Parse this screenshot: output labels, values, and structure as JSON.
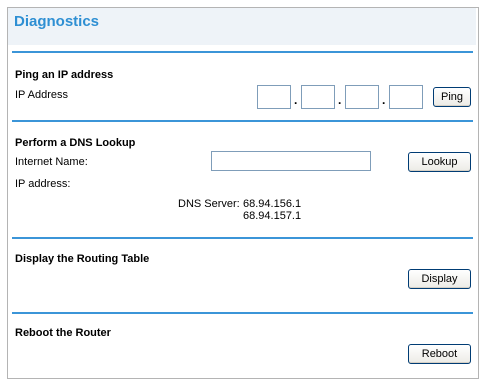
{
  "page": {
    "title": "Diagnostics"
  },
  "ping": {
    "heading": "Ping an IP address",
    "ip_label": "IP Address",
    "octets": [
      "",
      "",
      "",
      ""
    ],
    "separator": ".",
    "button": "Ping"
  },
  "dns": {
    "heading": "Perform a DNS Lookup",
    "name_label": "Internet Name:",
    "name_value": "",
    "ip_label": "IP address:",
    "button": "Lookup",
    "server_label": "DNS Server:",
    "servers": [
      "68.94.156.1",
      "68.94.157.1"
    ]
  },
  "routing": {
    "heading": "Display the Routing Table",
    "button": "Display"
  },
  "reboot": {
    "heading": "Reboot the Router",
    "button": "Reboot"
  },
  "colors": {
    "title": "#2e8fd3",
    "rule": "#3b95d8",
    "title_bar": "#eef3f8"
  }
}
